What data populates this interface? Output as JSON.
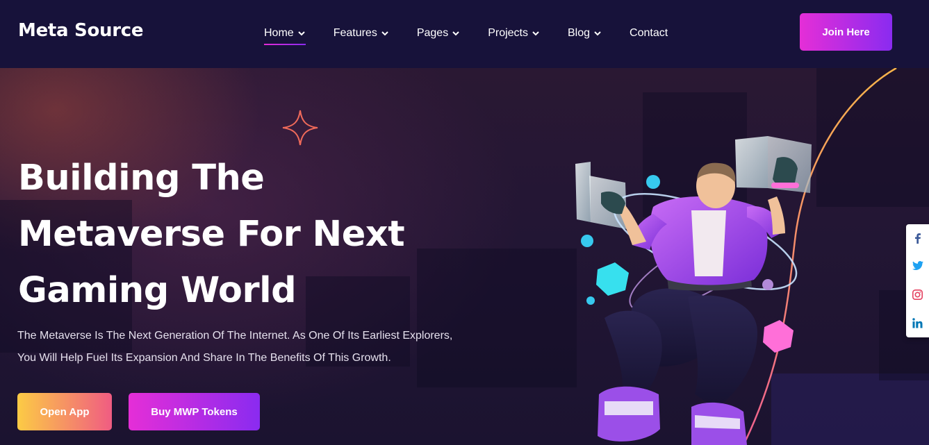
{
  "header": {
    "logo": "Meta Source",
    "nav": [
      {
        "label": "Home",
        "dropdown": true,
        "active": true
      },
      {
        "label": "Features",
        "dropdown": true
      },
      {
        "label": "Pages",
        "dropdown": true
      },
      {
        "label": "Projects",
        "dropdown": true
      },
      {
        "label": "Blog",
        "dropdown": true
      },
      {
        "label": "Contact",
        "dropdown": false
      }
    ],
    "cta": "Join Here"
  },
  "hero": {
    "title_lines": [
      "Building The",
      "Metaverse For Next",
      "Gaming World"
    ],
    "description_lines": [
      "The Metaverse Is The Next Generation Of The Internet. As One Of Its Earliest Explorers,",
      "You Will Help Fuel Its Expansion And Share In The Benefits Of This Growth."
    ],
    "primary_button": "Open App",
    "secondary_button": "Buy MWP Tokens"
  },
  "social": [
    {
      "icon": "facebook-icon",
      "color": "#3b5998"
    },
    {
      "icon": "twitter-icon",
      "color": "#1da1f2"
    },
    {
      "icon": "instagram-icon",
      "color": "#e4405f"
    },
    {
      "icon": "linkedin-icon",
      "color": "#0077b5"
    }
  ],
  "colors": {
    "nav_bg": "#17123a",
    "accent_pink": "#e52ed7",
    "accent_purple": "#8a2bf0",
    "accent_yellow": "#fccb45",
    "accent_coral": "#f05c82"
  }
}
